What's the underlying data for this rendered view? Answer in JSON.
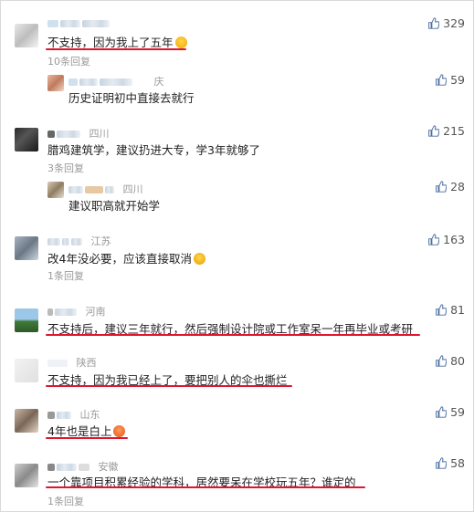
{
  "comments": [
    {
      "location": "",
      "text": "不支持，因为我上了五年",
      "emoji": "cry-emoji",
      "likes": "329",
      "replies_label": "10条回复",
      "reply": {
        "location": "庆",
        "text": "历史证明初中直接去就行",
        "likes": "59"
      }
    },
    {
      "location": "四川",
      "text": "腊鸡建筑学，建议扔进大专，学3年就够了",
      "likes": "215",
      "replies_label": "3条回复",
      "reply": {
        "location": "四川",
        "text": "建议职高就开始学",
        "likes": "28"
      }
    },
    {
      "location": "江苏",
      "text": "改4年没必要，应该直接取消",
      "emoji": "thinking-emoji",
      "likes": "163",
      "replies_label": "1条回复"
    },
    {
      "location": "河南",
      "text": "不支持后，建议三年就行，然后强制设计院或工作室呆一年再毕业或考研",
      "likes": "81"
    },
    {
      "location": "陕西",
      "text": "不支持，因为我已经上了，要把别人的伞也撕烂",
      "likes": "80"
    },
    {
      "location": "山东",
      "text": "4年也是白上",
      "emoji": "angry-emoji",
      "likes": "59"
    },
    {
      "location": "安徽",
      "text": "一个靠项目积累经验的学科，居然要呆在学校玩五年？谁定的",
      "likes": "58",
      "replies_label": "1条回复"
    }
  ],
  "colors": {
    "underline": "#e0152e",
    "meta": "#9a9a9a",
    "text": "#222222",
    "thumb": "#4a6da0"
  }
}
